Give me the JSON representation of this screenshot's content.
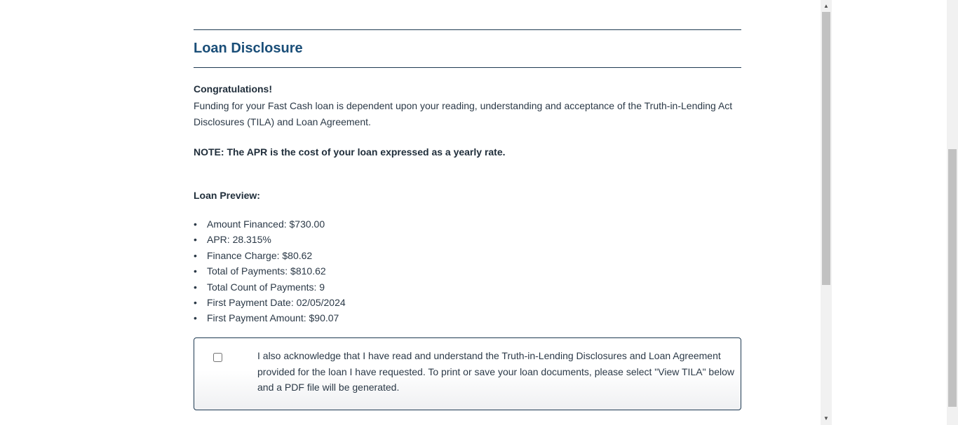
{
  "disclosure": {
    "title": "Loan Disclosure",
    "congrats": "Congratulations!",
    "funding_text": "Funding for your Fast Cash loan is dependent upon your reading, understanding and acceptance of the Truth-in-Lending Act Disclosures (TILA) and Loan Agreement.",
    "note": "NOTE: The APR is the cost of your loan expressed as a yearly rate."
  },
  "preview": {
    "heading": "Loan Preview:",
    "items": [
      "Amount Financed: $730.00",
      "APR: 28.315%",
      "Finance Charge: $80.62",
      "Total of Payments: $810.62",
      "Total Count of Payments: 9",
      "First Payment Date: 02/05/2024",
      "First Payment Amount: $90.07"
    ]
  },
  "acknowledgement": {
    "checked": false,
    "text": "I also acknowledge that I have read and understand the Truth-in-Lending Disclosures and Loan Agreement provided for the loan I have requested. To print or save your loan documents, please select \"View TILA\" below and a PDF file will be generated."
  },
  "icons": {
    "bullet": "•",
    "scroll_up": "▲",
    "scroll_down": "▼"
  }
}
